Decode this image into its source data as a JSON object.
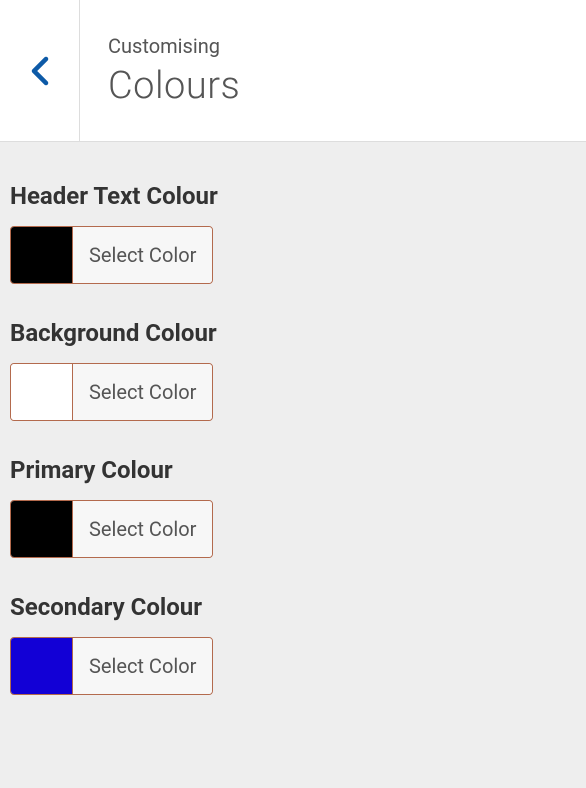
{
  "header": {
    "breadcrumb": "Customising",
    "title": "Colours"
  },
  "sections": [
    {
      "label": "Header Text Colour",
      "swatch": "#000000",
      "button": "Select Color"
    },
    {
      "label": "Background Colour",
      "swatch": "#ffffff",
      "button": "Select Color"
    },
    {
      "label": "Primary Colour",
      "swatch": "#000000",
      "button": "Select Color"
    },
    {
      "label": "Secondary Colour",
      "swatch": "#1200d6",
      "button": "Select Color"
    }
  ]
}
